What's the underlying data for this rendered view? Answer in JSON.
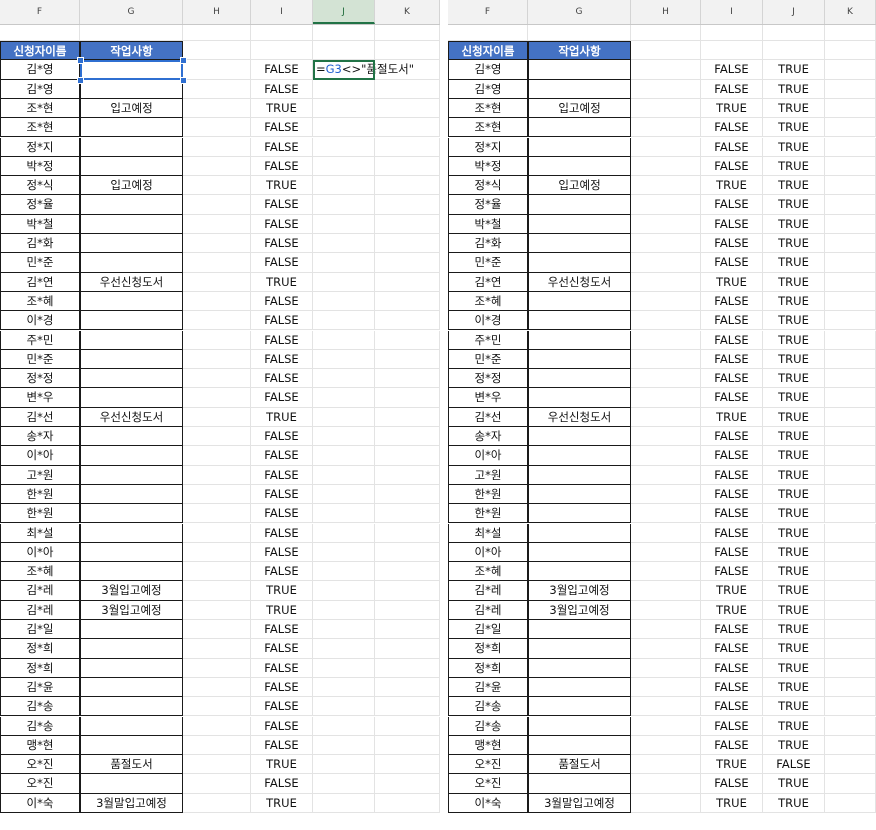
{
  "left": {
    "columns": [
      "F",
      "G",
      "H",
      "I",
      "J",
      "K"
    ],
    "selected_column": "J",
    "header": {
      "name": "신청자이름",
      "task": "작업사항"
    },
    "editing_formula": {
      "prefix": "=",
      "ref": "G3",
      "rest": "<>\"품절도서\""
    },
    "rows": [
      {
        "name": "김*영",
        "task": "",
        "i": "FALSE"
      },
      {
        "name": "김*영",
        "task": "",
        "i": "FALSE"
      },
      {
        "name": "조*현",
        "task": "입고예정",
        "i": "TRUE"
      },
      {
        "name": "조*현",
        "task": "",
        "i": "FALSE"
      },
      {
        "name": "정*지",
        "task": "",
        "i": "FALSE"
      },
      {
        "name": "박*정",
        "task": "",
        "i": "FALSE"
      },
      {
        "name": "정*식",
        "task": "입고예정",
        "i": "TRUE"
      },
      {
        "name": "정*율",
        "task": "",
        "i": "FALSE"
      },
      {
        "name": "박*철",
        "task": "",
        "i": "FALSE"
      },
      {
        "name": "김*화",
        "task": "",
        "i": "FALSE"
      },
      {
        "name": "민*준",
        "task": "",
        "i": "FALSE"
      },
      {
        "name": "김*연",
        "task": "우선신청도서",
        "i": "TRUE"
      },
      {
        "name": "조*혜",
        "task": "",
        "i": "FALSE"
      },
      {
        "name": "이*경",
        "task": "",
        "i": "FALSE"
      },
      {
        "name": "주*민",
        "task": "",
        "i": "FALSE"
      },
      {
        "name": "민*준",
        "task": "",
        "i": "FALSE"
      },
      {
        "name": "정*정",
        "task": "",
        "i": "FALSE"
      },
      {
        "name": "변*우",
        "task": "",
        "i": "FALSE"
      },
      {
        "name": "김*선",
        "task": "우선신청도서",
        "i": "TRUE"
      },
      {
        "name": "송*자",
        "task": "",
        "i": "FALSE"
      },
      {
        "name": "이*아",
        "task": "",
        "i": "FALSE"
      },
      {
        "name": "고*원",
        "task": "",
        "i": "FALSE"
      },
      {
        "name": "한*원",
        "task": "",
        "i": "FALSE"
      },
      {
        "name": "한*원",
        "task": "",
        "i": "FALSE"
      },
      {
        "name": "최*설",
        "task": "",
        "i": "FALSE"
      },
      {
        "name": "이*아",
        "task": "",
        "i": "FALSE"
      },
      {
        "name": "조*혜",
        "task": "",
        "i": "FALSE"
      },
      {
        "name": "김*레",
        "task": "3월입고예정",
        "i": "TRUE"
      },
      {
        "name": "김*레",
        "task": "3월입고예정",
        "i": "TRUE"
      },
      {
        "name": "김*일",
        "task": "",
        "i": "FALSE"
      },
      {
        "name": "정*희",
        "task": "",
        "i": "FALSE"
      },
      {
        "name": "정*희",
        "task": "",
        "i": "FALSE"
      },
      {
        "name": "김*윤",
        "task": "",
        "i": "FALSE"
      },
      {
        "name": "김*송",
        "task": "",
        "i": "FALSE"
      },
      {
        "name": "김*송",
        "task": "",
        "i": "FALSE"
      },
      {
        "name": "맹*현",
        "task": "",
        "i": "FALSE"
      },
      {
        "name": "오*진",
        "task": "품절도서",
        "i": "TRUE"
      },
      {
        "name": "오*진",
        "task": "",
        "i": "FALSE"
      },
      {
        "name": "이*숙",
        "task": "3월말입고예정",
        "i": "TRUE"
      }
    ]
  },
  "right": {
    "columns": [
      "F",
      "G",
      "H",
      "I",
      "J",
      "K"
    ],
    "header": {
      "name": "신청자이름",
      "task": "작업사항"
    },
    "rows": [
      {
        "name": "김*영",
        "task": "",
        "i": "FALSE",
        "j": "TRUE"
      },
      {
        "name": "김*영",
        "task": "",
        "i": "FALSE",
        "j": "TRUE"
      },
      {
        "name": "조*현",
        "task": "입고예정",
        "i": "TRUE",
        "j": "TRUE"
      },
      {
        "name": "조*현",
        "task": "",
        "i": "FALSE",
        "j": "TRUE"
      },
      {
        "name": "정*지",
        "task": "",
        "i": "FALSE",
        "j": "TRUE"
      },
      {
        "name": "박*정",
        "task": "",
        "i": "FALSE",
        "j": "TRUE"
      },
      {
        "name": "정*식",
        "task": "입고예정",
        "i": "TRUE",
        "j": "TRUE"
      },
      {
        "name": "정*율",
        "task": "",
        "i": "FALSE",
        "j": "TRUE"
      },
      {
        "name": "박*철",
        "task": "",
        "i": "FALSE",
        "j": "TRUE"
      },
      {
        "name": "김*화",
        "task": "",
        "i": "FALSE",
        "j": "TRUE"
      },
      {
        "name": "민*준",
        "task": "",
        "i": "FALSE",
        "j": "TRUE"
      },
      {
        "name": "김*연",
        "task": "우선신청도서",
        "i": "TRUE",
        "j": "TRUE"
      },
      {
        "name": "조*혜",
        "task": "",
        "i": "FALSE",
        "j": "TRUE"
      },
      {
        "name": "이*경",
        "task": "",
        "i": "FALSE",
        "j": "TRUE"
      },
      {
        "name": "주*민",
        "task": "",
        "i": "FALSE",
        "j": "TRUE"
      },
      {
        "name": "민*준",
        "task": "",
        "i": "FALSE",
        "j": "TRUE"
      },
      {
        "name": "정*정",
        "task": "",
        "i": "FALSE",
        "j": "TRUE"
      },
      {
        "name": "변*우",
        "task": "",
        "i": "FALSE",
        "j": "TRUE"
      },
      {
        "name": "김*선",
        "task": "우선신청도서",
        "i": "TRUE",
        "j": "TRUE"
      },
      {
        "name": "송*자",
        "task": "",
        "i": "FALSE",
        "j": "TRUE"
      },
      {
        "name": "이*아",
        "task": "",
        "i": "FALSE",
        "j": "TRUE"
      },
      {
        "name": "고*원",
        "task": "",
        "i": "FALSE",
        "j": "TRUE"
      },
      {
        "name": "한*원",
        "task": "",
        "i": "FALSE",
        "j": "TRUE"
      },
      {
        "name": "한*원",
        "task": "",
        "i": "FALSE",
        "j": "TRUE"
      },
      {
        "name": "최*설",
        "task": "",
        "i": "FALSE",
        "j": "TRUE"
      },
      {
        "name": "이*아",
        "task": "",
        "i": "FALSE",
        "j": "TRUE"
      },
      {
        "name": "조*혜",
        "task": "",
        "i": "FALSE",
        "j": "TRUE"
      },
      {
        "name": "김*레",
        "task": "3월입고예정",
        "i": "TRUE",
        "j": "TRUE"
      },
      {
        "name": "김*레",
        "task": "3월입고예정",
        "i": "TRUE",
        "j": "TRUE"
      },
      {
        "name": "김*일",
        "task": "",
        "i": "FALSE",
        "j": "TRUE"
      },
      {
        "name": "정*희",
        "task": "",
        "i": "FALSE",
        "j": "TRUE"
      },
      {
        "name": "정*희",
        "task": "",
        "i": "FALSE",
        "j": "TRUE"
      },
      {
        "name": "김*윤",
        "task": "",
        "i": "FALSE",
        "j": "TRUE"
      },
      {
        "name": "김*송",
        "task": "",
        "i": "FALSE",
        "j": "TRUE"
      },
      {
        "name": "김*송",
        "task": "",
        "i": "FALSE",
        "j": "TRUE"
      },
      {
        "name": "맹*현",
        "task": "",
        "i": "FALSE",
        "j": "TRUE"
      },
      {
        "name": "오*진",
        "task": "품절도서",
        "i": "TRUE",
        "j": "FALSE"
      },
      {
        "name": "오*진",
        "task": "",
        "i": "FALSE",
        "j": "TRUE"
      },
      {
        "name": "이*숙",
        "task": "3월말입고예정",
        "i": "TRUE",
        "j": "TRUE"
      }
    ]
  },
  "colors": {
    "header_fill": "#4472c4",
    "selection": "#2f6fd1",
    "edit_border": "#217346",
    "formula_ref": "#1f5fd1"
  }
}
